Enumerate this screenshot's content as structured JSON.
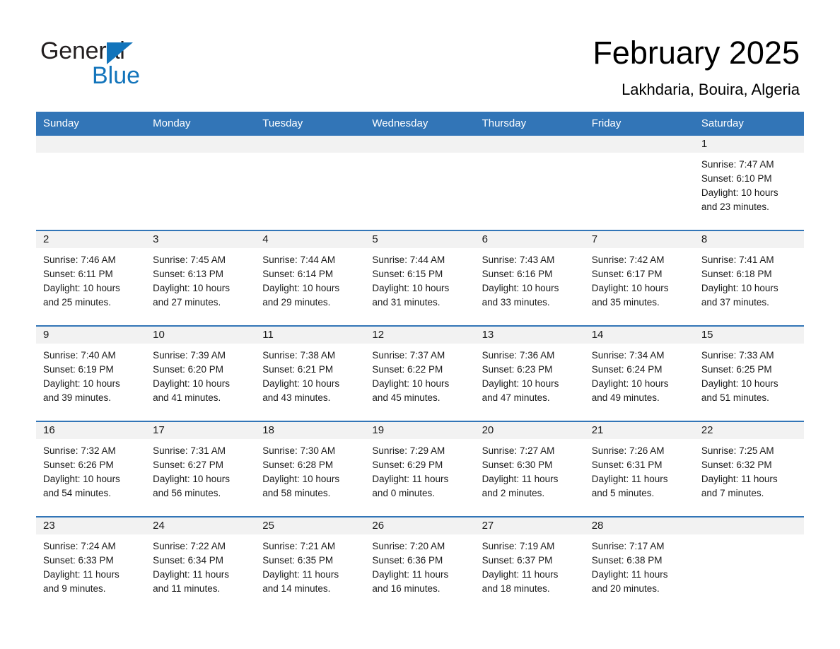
{
  "brand": {
    "name_part1": "General",
    "name_part2": "Blue",
    "triangle_color": "#1274bb",
    "blue_color": "#1274bb"
  },
  "header": {
    "month_title": "February 2025",
    "location": "Lakhdaria, Bouira, Algeria"
  },
  "theme": {
    "header_blue": "#3275b7",
    "daynum_band": "#f2f2f2",
    "divider_blue": "#3275b7",
    "text": "#1a1a1a"
  },
  "weekday_headers": [
    "Sunday",
    "Monday",
    "Tuesday",
    "Wednesday",
    "Thursday",
    "Friday",
    "Saturday"
  ],
  "weeks": [
    [
      {
        "day": "",
        "blank": true
      },
      {
        "day": "",
        "blank": true
      },
      {
        "day": "",
        "blank": true
      },
      {
        "day": "",
        "blank": true
      },
      {
        "day": "",
        "blank": true
      },
      {
        "day": "",
        "blank": true
      },
      {
        "day": "1",
        "sunrise": "Sunrise: 7:47 AM",
        "sunset": "Sunset: 6:10 PM",
        "daylight_1": "Daylight: 10 hours",
        "daylight_2": "and 23 minutes."
      }
    ],
    [
      {
        "day": "2",
        "sunrise": "Sunrise: 7:46 AM",
        "sunset": "Sunset: 6:11 PM",
        "daylight_1": "Daylight: 10 hours",
        "daylight_2": "and 25 minutes."
      },
      {
        "day": "3",
        "sunrise": "Sunrise: 7:45 AM",
        "sunset": "Sunset: 6:13 PM",
        "daylight_1": "Daylight: 10 hours",
        "daylight_2": "and 27 minutes."
      },
      {
        "day": "4",
        "sunrise": "Sunrise: 7:44 AM",
        "sunset": "Sunset: 6:14 PM",
        "daylight_1": "Daylight: 10 hours",
        "daylight_2": "and 29 minutes."
      },
      {
        "day": "5",
        "sunrise": "Sunrise: 7:44 AM",
        "sunset": "Sunset: 6:15 PM",
        "daylight_1": "Daylight: 10 hours",
        "daylight_2": "and 31 minutes."
      },
      {
        "day": "6",
        "sunrise": "Sunrise: 7:43 AM",
        "sunset": "Sunset: 6:16 PM",
        "daylight_1": "Daylight: 10 hours",
        "daylight_2": "and 33 minutes."
      },
      {
        "day": "7",
        "sunrise": "Sunrise: 7:42 AM",
        "sunset": "Sunset: 6:17 PM",
        "daylight_1": "Daylight: 10 hours",
        "daylight_2": "and 35 minutes."
      },
      {
        "day": "8",
        "sunrise": "Sunrise: 7:41 AM",
        "sunset": "Sunset: 6:18 PM",
        "daylight_1": "Daylight: 10 hours",
        "daylight_2": "and 37 minutes."
      }
    ],
    [
      {
        "day": "9",
        "sunrise": "Sunrise: 7:40 AM",
        "sunset": "Sunset: 6:19 PM",
        "daylight_1": "Daylight: 10 hours",
        "daylight_2": "and 39 minutes."
      },
      {
        "day": "10",
        "sunrise": "Sunrise: 7:39 AM",
        "sunset": "Sunset: 6:20 PM",
        "daylight_1": "Daylight: 10 hours",
        "daylight_2": "and 41 minutes."
      },
      {
        "day": "11",
        "sunrise": "Sunrise: 7:38 AM",
        "sunset": "Sunset: 6:21 PM",
        "daylight_1": "Daylight: 10 hours",
        "daylight_2": "and 43 minutes."
      },
      {
        "day": "12",
        "sunrise": "Sunrise: 7:37 AM",
        "sunset": "Sunset: 6:22 PM",
        "daylight_1": "Daylight: 10 hours",
        "daylight_2": "and 45 minutes."
      },
      {
        "day": "13",
        "sunrise": "Sunrise: 7:36 AM",
        "sunset": "Sunset: 6:23 PM",
        "daylight_1": "Daylight: 10 hours",
        "daylight_2": "and 47 minutes."
      },
      {
        "day": "14",
        "sunrise": "Sunrise: 7:34 AM",
        "sunset": "Sunset: 6:24 PM",
        "daylight_1": "Daylight: 10 hours",
        "daylight_2": "and 49 minutes."
      },
      {
        "day": "15",
        "sunrise": "Sunrise: 7:33 AM",
        "sunset": "Sunset: 6:25 PM",
        "daylight_1": "Daylight: 10 hours",
        "daylight_2": "and 51 minutes."
      }
    ],
    [
      {
        "day": "16",
        "sunrise": "Sunrise: 7:32 AM",
        "sunset": "Sunset: 6:26 PM",
        "daylight_1": "Daylight: 10 hours",
        "daylight_2": "and 54 minutes."
      },
      {
        "day": "17",
        "sunrise": "Sunrise: 7:31 AM",
        "sunset": "Sunset: 6:27 PM",
        "daylight_1": "Daylight: 10 hours",
        "daylight_2": "and 56 minutes."
      },
      {
        "day": "18",
        "sunrise": "Sunrise: 7:30 AM",
        "sunset": "Sunset: 6:28 PM",
        "daylight_1": "Daylight: 10 hours",
        "daylight_2": "and 58 minutes."
      },
      {
        "day": "19",
        "sunrise": "Sunrise: 7:29 AM",
        "sunset": "Sunset: 6:29 PM",
        "daylight_1": "Daylight: 11 hours",
        "daylight_2": "and 0 minutes."
      },
      {
        "day": "20",
        "sunrise": "Sunrise: 7:27 AM",
        "sunset": "Sunset: 6:30 PM",
        "daylight_1": "Daylight: 11 hours",
        "daylight_2": "and 2 minutes."
      },
      {
        "day": "21",
        "sunrise": "Sunrise: 7:26 AM",
        "sunset": "Sunset: 6:31 PM",
        "daylight_1": "Daylight: 11 hours",
        "daylight_2": "and 5 minutes."
      },
      {
        "day": "22",
        "sunrise": "Sunrise: 7:25 AM",
        "sunset": "Sunset: 6:32 PM",
        "daylight_1": "Daylight: 11 hours",
        "daylight_2": "and 7 minutes."
      }
    ],
    [
      {
        "day": "23",
        "sunrise": "Sunrise: 7:24 AM",
        "sunset": "Sunset: 6:33 PM",
        "daylight_1": "Daylight: 11 hours",
        "daylight_2": "and 9 minutes."
      },
      {
        "day": "24",
        "sunrise": "Sunrise: 7:22 AM",
        "sunset": "Sunset: 6:34 PM",
        "daylight_1": "Daylight: 11 hours",
        "daylight_2": "and 11 minutes."
      },
      {
        "day": "25",
        "sunrise": "Sunrise: 7:21 AM",
        "sunset": "Sunset: 6:35 PM",
        "daylight_1": "Daylight: 11 hours",
        "daylight_2": "and 14 minutes."
      },
      {
        "day": "26",
        "sunrise": "Sunrise: 7:20 AM",
        "sunset": "Sunset: 6:36 PM",
        "daylight_1": "Daylight: 11 hours",
        "daylight_2": "and 16 minutes."
      },
      {
        "day": "27",
        "sunrise": "Sunrise: 7:19 AM",
        "sunset": "Sunset: 6:37 PM",
        "daylight_1": "Daylight: 11 hours",
        "daylight_2": "and 18 minutes."
      },
      {
        "day": "28",
        "sunrise": "Sunrise: 7:17 AM",
        "sunset": "Sunset: 6:38 PM",
        "daylight_1": "Daylight: 11 hours",
        "daylight_2": "and 20 minutes."
      },
      {
        "day": "",
        "blank": true
      }
    ]
  ]
}
